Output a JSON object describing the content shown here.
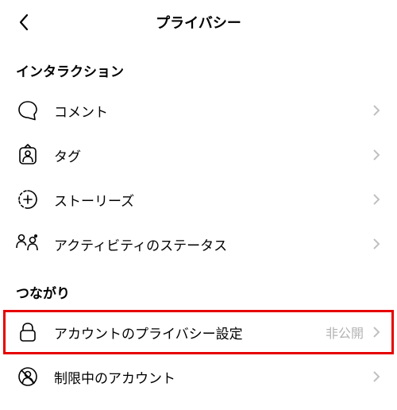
{
  "header": {
    "title": "プライバシー"
  },
  "sections": {
    "interaction": {
      "title": "インタラクション",
      "items": {
        "comments": {
          "label": "コメント"
        },
        "tags": {
          "label": "タグ"
        },
        "stories": {
          "label": "ストーリーズ"
        },
        "activity_status": {
          "label": "アクティビティのステータス"
        }
      }
    },
    "connection": {
      "title": "つながり",
      "items": {
        "account_privacy": {
          "label": "アカウントのプライバシー設定",
          "value": "非公開"
        },
        "restricted": {
          "label": "制限中のアカウント"
        }
      }
    }
  }
}
